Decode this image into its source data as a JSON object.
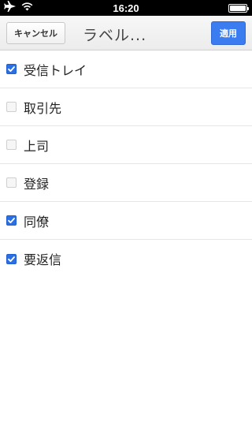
{
  "status_bar": {
    "time": "16:20",
    "icons": [
      "airplane-icon",
      "wifi-icon",
      "battery-icon"
    ],
    "battery_level": 1.0
  },
  "nav": {
    "cancel_label": "キャンセル",
    "title": "ラベル...",
    "apply_label": "適用"
  },
  "labels": [
    {
      "name": "受信トレイ",
      "checked": true
    },
    {
      "name": "取引先",
      "checked": false
    },
    {
      "name": "上司",
      "checked": false
    },
    {
      "name": "登録",
      "checked": false
    },
    {
      "name": "同僚",
      "checked": true
    },
    {
      "name": "要返信",
      "checked": true
    }
  ],
  "colors": {
    "accent": "#3b7cf0",
    "checkbox_checked": "#2a6fe3"
  }
}
